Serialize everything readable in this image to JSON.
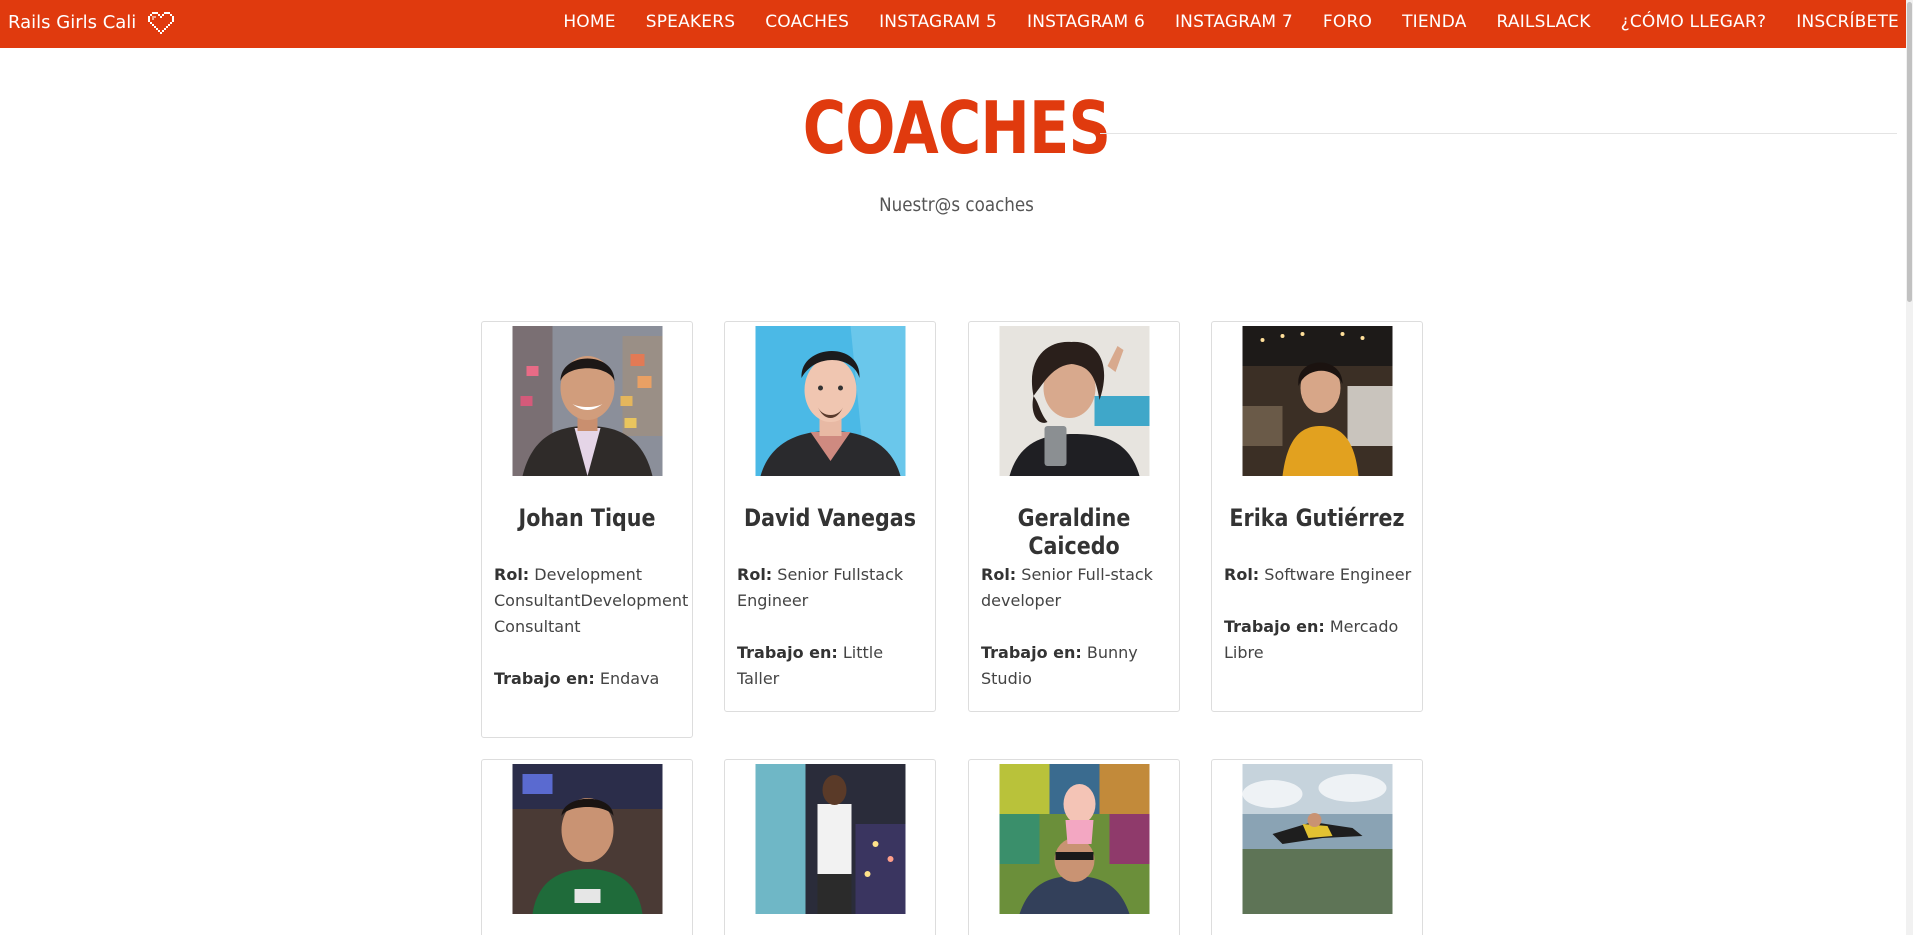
{
  "nav": {
    "brand": "Rails Girls Cali",
    "items": [
      "HOME",
      "SPEAKERS",
      "COACHES",
      "INSTAGRAM 5",
      "INSTAGRAM 6",
      "INSTAGRAM 7",
      "FORO",
      "TIENDA",
      "RAILSLACK",
      "¿CÓMO LLEGAR?",
      "INSCRÍBETE"
    ]
  },
  "section": {
    "title": "COACHES",
    "subtitle": "Nuestr@s coaches"
  },
  "labels": {
    "role": "Rol:",
    "work": "Trabajo en:"
  },
  "coaches": [
    {
      "name": "Johan Tique",
      "role": "Development ConsultantDevelopment Consultant",
      "work": "Endava"
    },
    {
      "name": "David Vanegas",
      "role": "Senior Fullstack Engineer",
      "work": "Little Taller"
    },
    {
      "name": "Geraldine Caicedo",
      "role": "Senior Full-stack developer",
      "work": "Bunny Studio"
    },
    {
      "name": "Erika Gutiérrez",
      "role": "Software Engineer",
      "work": "Mercado Libre"
    }
  ],
  "colors": {
    "brand": "#e03a0e",
    "card_border": "#dddddd"
  }
}
